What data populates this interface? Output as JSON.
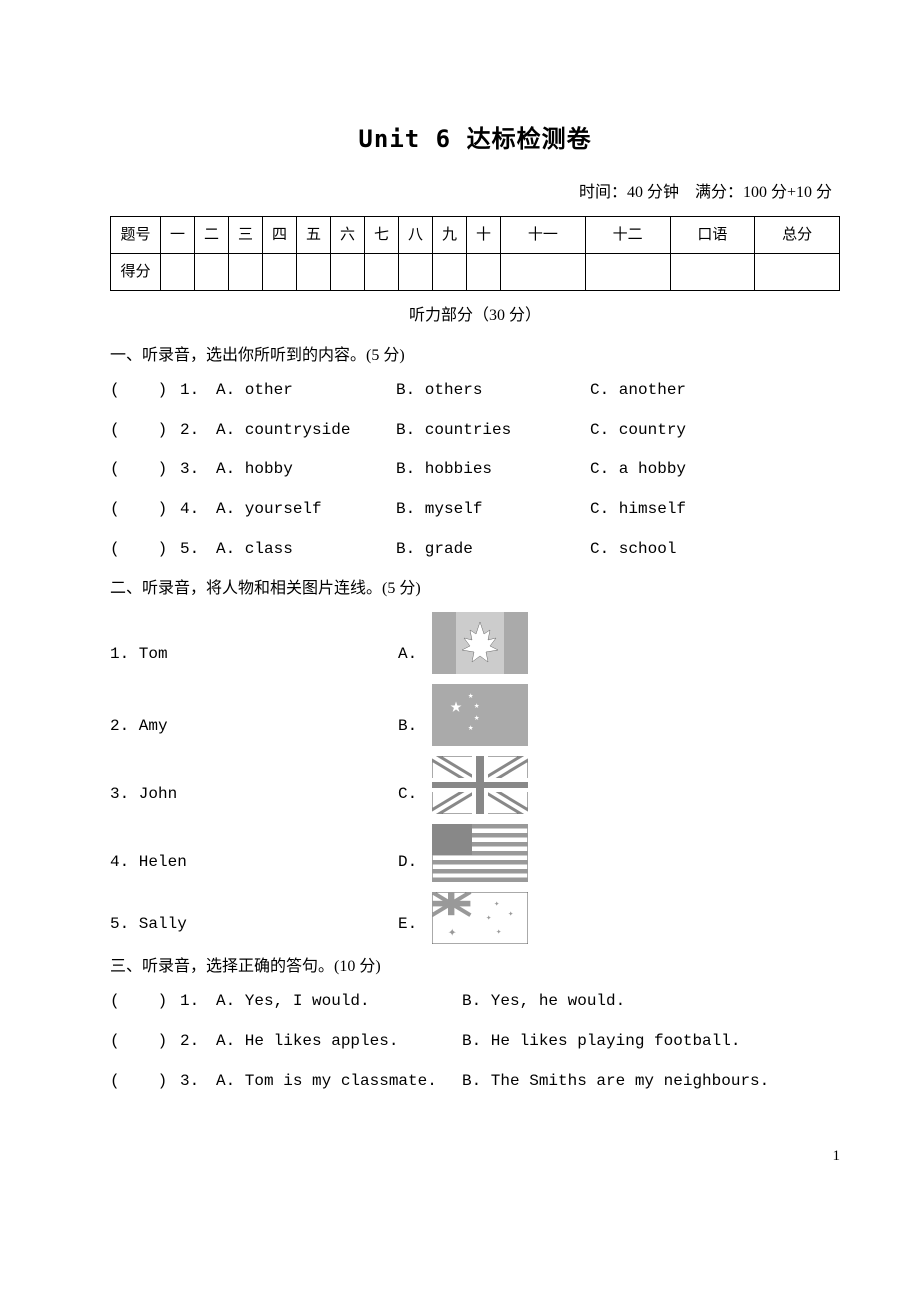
{
  "title": "Unit 6 达标检测卷",
  "time_info": "时间：40 分钟　满分：100 分+10 分",
  "score_table": {
    "row1_label": "题号",
    "row2_label": "得分",
    "cols": [
      "一",
      "二",
      "三",
      "四",
      "五",
      "六",
      "七",
      "八",
      "九",
      "十",
      "十一",
      "十二",
      "口语",
      "总分"
    ]
  },
  "listening_header": "听力部分（30 分）",
  "section1": {
    "heading": "一、听录音，选出你所听到的内容。(5 分)",
    "paren": "(　　)",
    "items": [
      {
        "num": "1.",
        "a": "A. other",
        "b": "B. others",
        "c": "C. another"
      },
      {
        "num": "2.",
        "a": "A. countryside",
        "b": "B. countries",
        "c": "C. country"
      },
      {
        "num": "3.",
        "a": "A. hobby",
        "b": "B. hobbies",
        "c": "C. a hobby"
      },
      {
        "num": "4.",
        "a": "A. yourself",
        "b": "B. myself",
        "c": "C. himself"
      },
      {
        "num": "5.",
        "a": "A. class",
        "b": "B. grade",
        "c": "C. school"
      }
    ]
  },
  "section2": {
    "heading": "二、听录音，将人物和相关图片连线。(5 分)",
    "items": [
      {
        "name": "1. Tom",
        "letter": "A."
      },
      {
        "name": "2. Amy",
        "letter": "B."
      },
      {
        "name": "3. John",
        "letter": "C."
      },
      {
        "name": "4. Helen",
        "letter": "D."
      },
      {
        "name": "5. Sally",
        "letter": "E."
      }
    ]
  },
  "section3": {
    "heading": "三、听录音，选择正确的答句。(10 分)",
    "paren": "(　　)",
    "items": [
      {
        "num": "1.",
        "a": "A. Yes, I would.",
        "b": "B. Yes, he would."
      },
      {
        "num": "2.",
        "a": "A. He likes apples.",
        "b": "B. He likes playing football."
      },
      {
        "num": "3.",
        "a": "A. Tom is my classmate.",
        "b": "B. The Smiths are my neighbours."
      }
    ]
  },
  "page_number": "1"
}
